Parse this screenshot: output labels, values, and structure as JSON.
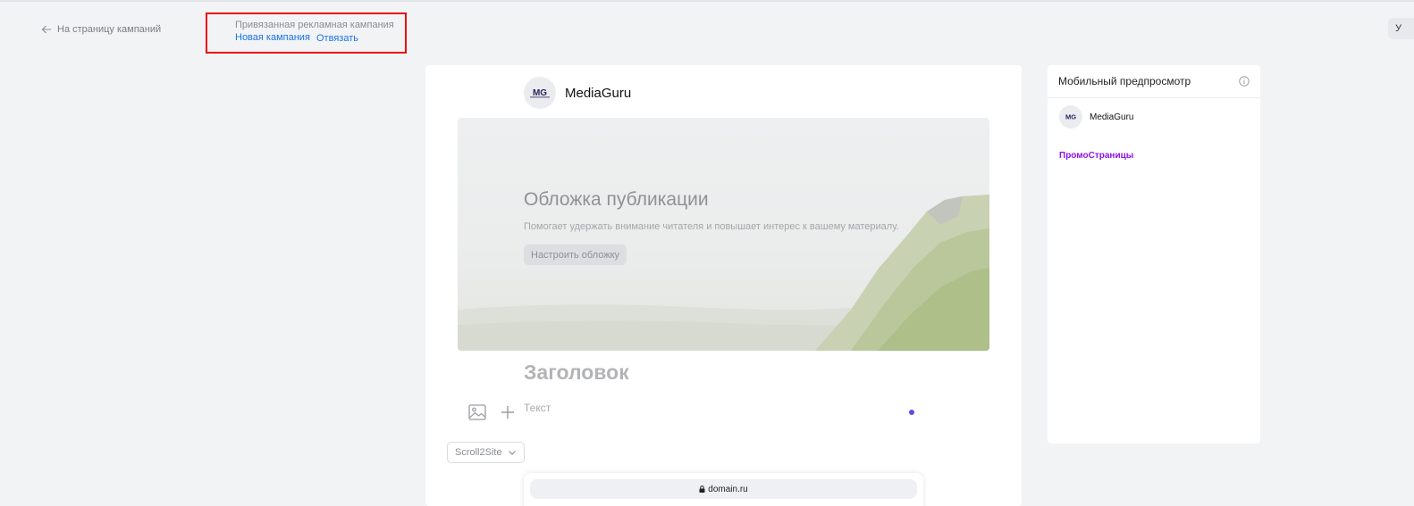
{
  "nav": {
    "back_label": "На страницу кампаний"
  },
  "campaign": {
    "label": "Привязанная рекламная кампания",
    "name_link": "Новая кампания",
    "unlink_label": "Отвязать"
  },
  "top_right": {
    "chip_text": "У"
  },
  "editor": {
    "author_name": "MediaGuru",
    "avatar_text": "MG",
    "cover": {
      "title": "Обложка публикации",
      "description": "Помогает удержать внимание читателя и повышает интерес к вашему материалу.",
      "button_label": "Настроить обложку"
    },
    "headline_placeholder": "Заголовок",
    "text_placeholder": "Текст",
    "scroll_select": {
      "value": "Scroll2Site"
    },
    "preview": {
      "domain": "domain.ru"
    }
  },
  "mobile_preview": {
    "title": "Мобильный предпросмотр",
    "author_name": "MediaGuru",
    "avatar_text": "MG",
    "promo_link": "ПромоСтраницы"
  },
  "colors": {
    "accent_link": "#1a73e8",
    "highlight_border": "#ea0b0b",
    "promo_purple": "#8a16e8",
    "dot": "#5a4ee8"
  }
}
